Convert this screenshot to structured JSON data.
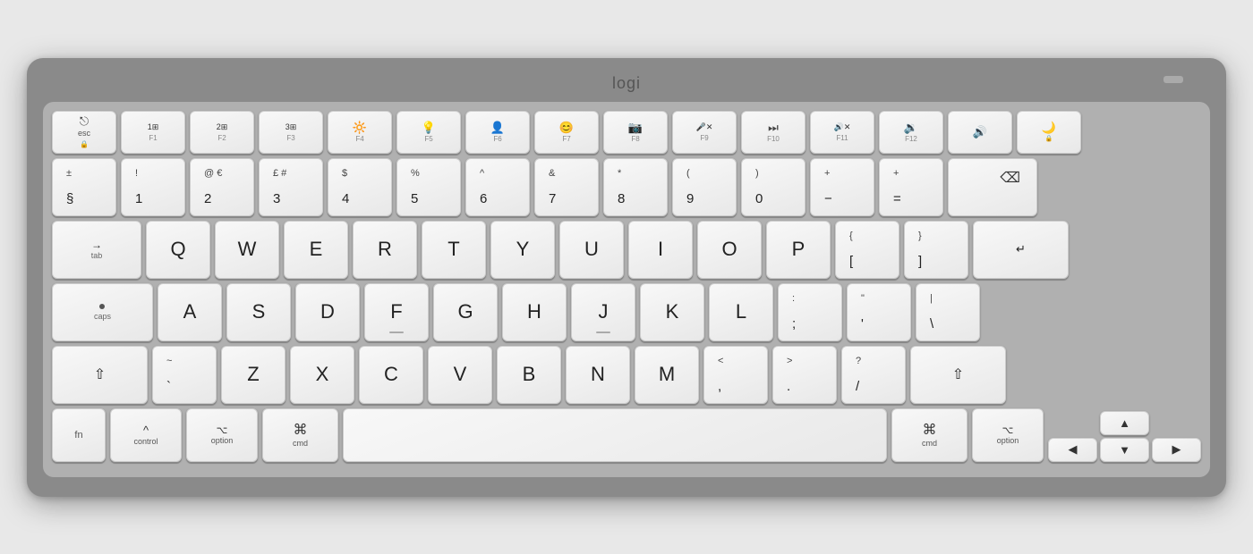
{
  "keyboard": {
    "brand": "logi",
    "rows": {
      "fn_row": [
        "esc",
        "F1",
        "F2",
        "F3",
        "F4",
        "F5",
        "F6",
        "F7",
        "F8",
        "F9",
        "F10",
        "F11",
        "F12",
        "moon"
      ],
      "number_row": [
        "±§",
        "!1",
        "@2€",
        "£3#",
        "$4",
        "%5",
        "^6",
        "&7",
        "*8",
        "(9",
        ")0",
        "−",
        "=+",
        "del"
      ],
      "qwerty_row": [
        "tab",
        "Q",
        "W",
        "E",
        "R",
        "T",
        "Y",
        "U",
        "I",
        "O",
        "P",
        "{[",
        "}]",
        "return"
      ],
      "asdf_row": [
        "caps",
        "A",
        "S",
        "D",
        "F",
        "G",
        "H",
        "J",
        "K",
        "L",
        ";:",
        "'\"",
        "\\|"
      ],
      "zxcv_row": [
        "shift",
        "Z",
        "X",
        "C",
        "V",
        "B",
        "N",
        "M",
        "<,",
        ">.",
        "?/",
        "shift_r"
      ],
      "bottom_row": [
        "fn",
        "control",
        "option",
        "cmd",
        "space",
        "cmd_r",
        "option_r",
        "arrows"
      ]
    }
  }
}
